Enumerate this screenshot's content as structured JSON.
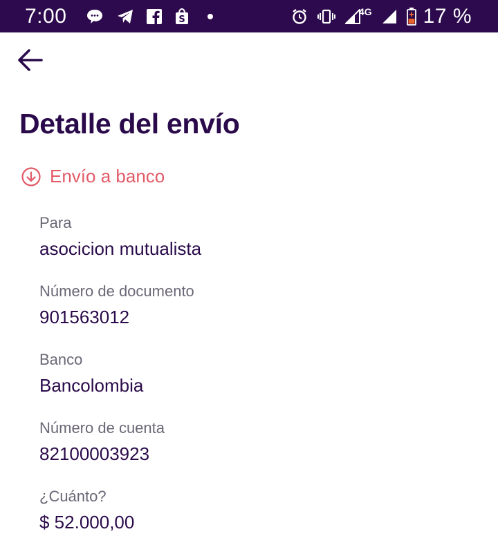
{
  "status_bar": {
    "time": "7:00",
    "left_icons": [
      "chat-bubble-icon",
      "telegram-icon",
      "facebook-icon",
      "shopping-bag-icon",
      "notification-dot"
    ],
    "right_icons": [
      "alarm-icon",
      "vibrate-icon",
      "signal-icon",
      "signal-icon-2",
      "battery-icon"
    ],
    "network": "4G",
    "battery_percent": "17 %"
  },
  "header": {
    "back_icon": "arrow-left-icon",
    "title": "Detalle del envío"
  },
  "transfer": {
    "icon": "arrow-down-circle-icon",
    "type_label": "Envío a banco",
    "accent_color": "#e25a67"
  },
  "details": [
    {
      "label": "Para",
      "value": "asocicion mutualista"
    },
    {
      "label": "Número de documento",
      "value": "901563012"
    },
    {
      "label": "Banco",
      "value": "Bancolombia"
    },
    {
      "label": "Número de cuenta",
      "value": "82100003923"
    },
    {
      "label": "¿Cuánto?",
      "value": "$ 52.000,00"
    }
  ],
  "colors": {
    "status_bar_bg": "#2c0a4d",
    "primary_text": "#2a0a4a",
    "secondary_text": "#6b6776"
  }
}
